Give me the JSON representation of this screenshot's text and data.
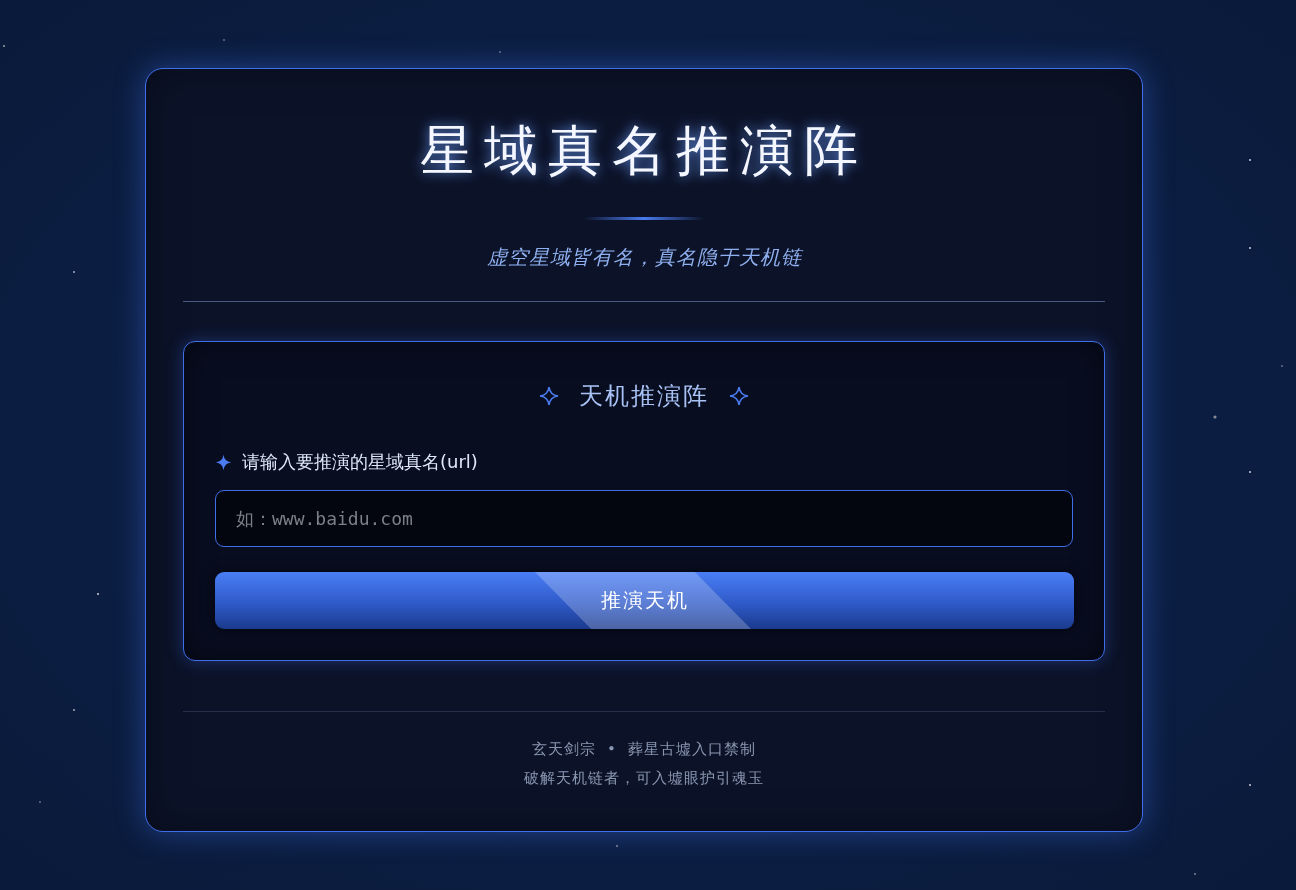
{
  "title": "星域真名推演阵",
  "subtitle": "虚空星域皆有名，真名隐于天机链",
  "panel": {
    "title": "天机推演阵",
    "field_label": "请输入要推演的星域真名(url)",
    "input": {
      "placeholder": "如：www.baidu.com"
    },
    "button": "推演天机"
  },
  "footer": [
    "玄天剑宗  •  葬星古墟入口禁制",
    "破解天机链者，可入墟眼护引魂玉"
  ]
}
